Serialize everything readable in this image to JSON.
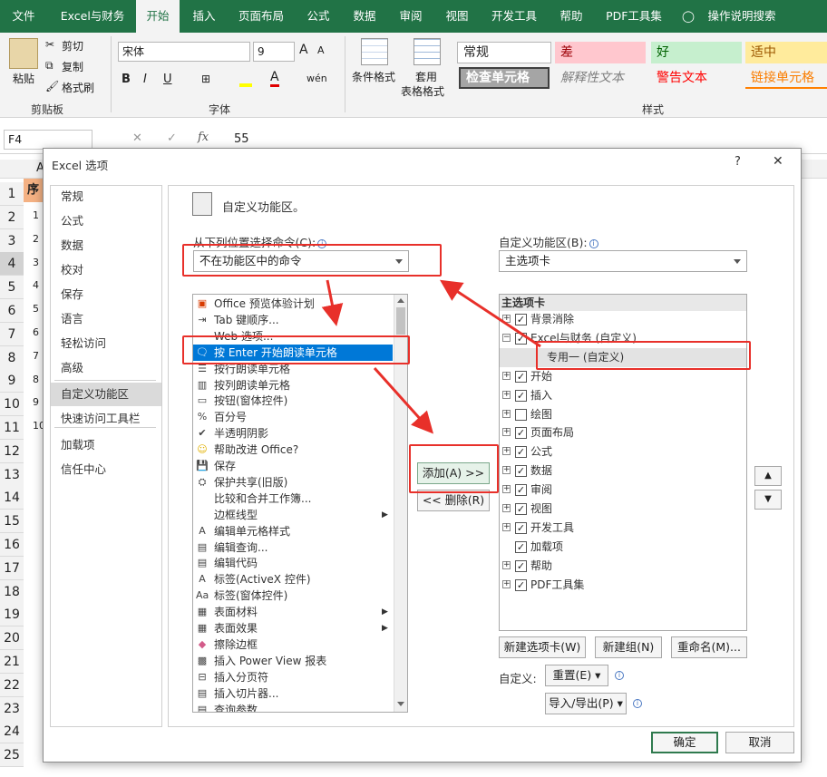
{
  "ribbon_tabs": [
    "文件",
    "Excel与财务",
    "开始",
    "插入",
    "页面布局",
    "公式",
    "数据",
    "审阅",
    "视图",
    "开发工具",
    "帮助",
    "PDF工具集",
    "操作说明搜索"
  ],
  "clipboard": {
    "paste": "粘贴",
    "cut": "剪切",
    "copy": "复制",
    "format_painter": "格式刷",
    "group": "剪贴板"
  },
  "font": {
    "name": "宋体",
    "size": "9",
    "group": "字体",
    "bold": "B",
    "italic": "I",
    "underline": "U"
  },
  "styles": {
    "cond_format": "条件格式",
    "table_format_1": "套用",
    "table_format_2": "表格格式",
    "group": "样式",
    "normal": "常规",
    "bad": "差",
    "good": "好",
    "neutral": "适中",
    "check_cell": "检查单元格",
    "explanatory": "解释性文本",
    "warning": "警告文本",
    "linked_cell": "链接单元格"
  },
  "formula_bar": {
    "cell_ref": "F4",
    "value": "55",
    "fx": "fx"
  },
  "sheet": {
    "col_a": "A",
    "header_cell": "序",
    "rows": [
      "1",
      "2",
      "3",
      "4",
      "5",
      "6",
      "7",
      "8",
      "9",
      "10",
      "11",
      "12",
      "13",
      "14",
      "15",
      "16",
      "17",
      "18",
      "19",
      "20",
      "21",
      "22",
      "23",
      "24",
      "25"
    ],
    "a_values": [
      "1",
      "2",
      "3",
      "4",
      "5",
      "6",
      "7",
      "8",
      "9",
      "10"
    ]
  },
  "dialog": {
    "title": "Excel 选项",
    "help": "?",
    "close": "✕",
    "nav": [
      "常规",
      "公式",
      "数据",
      "校对",
      "保存",
      "语言",
      "轻松访问",
      "高级",
      "自定义功能区",
      "快速访问工具栏",
      "加载项",
      "信任中心"
    ],
    "section_title": "自定义功能区。",
    "left_label": "从下列位置选择命令(C):",
    "left_dropdown": "不在功能区中的命令",
    "right_label": "自定义功能区(B):",
    "right_dropdown": "主选项卡",
    "commands": [
      {
        "icon": "office-icon",
        "text": "Office 预览体验计划"
      },
      {
        "icon": "tab-order-icon",
        "text": "Tab 键顺序..."
      },
      {
        "icon": "web-icon",
        "text": "Web 选项..."
      },
      {
        "icon": "speak-enter-icon",
        "text": "按 Enter 开始朗读单元格"
      },
      {
        "icon": "speak-rows-icon",
        "text": "按行朗读单元格"
      },
      {
        "icon": "speak-cols-icon",
        "text": "按列朗读单元格"
      },
      {
        "icon": "button-form-icon",
        "text": "按钮(窗体控件)"
      },
      {
        "icon": "percent-icon",
        "text": "百分号"
      },
      {
        "icon": "check-icon",
        "text": "半透明阴影"
      },
      {
        "icon": "smiley-icon",
        "text": "帮助改进 Office?"
      },
      {
        "icon": "save-icon",
        "text": "保存"
      },
      {
        "icon": "share-icon",
        "text": "保护共享(旧版)"
      },
      {
        "icon": "blank-icon",
        "text": "比较和合并工作簿..."
      },
      {
        "icon": "blank-icon",
        "text": "边框线型"
      },
      {
        "icon": "cell-style-icon",
        "text": "编辑单元格样式"
      },
      {
        "icon": "query-icon",
        "text": "编辑查询..."
      },
      {
        "icon": "code-icon",
        "text": "编辑代码"
      },
      {
        "icon": "label-icon",
        "text": "标签(ActiveX 控件)"
      },
      {
        "icon": "label-form-icon",
        "text": "标签(窗体控件)"
      },
      {
        "icon": "texture-icon",
        "text": "表面材料"
      },
      {
        "icon": "effect-icon",
        "text": "表面效果"
      },
      {
        "icon": "eraser-icon",
        "text": "擦除边框"
      },
      {
        "icon": "pivot-icon",
        "text": "插入 Power View 报表"
      },
      {
        "icon": "page-break-icon",
        "text": "插入分页符"
      },
      {
        "icon": "slicer-icon",
        "text": "插入切片器..."
      },
      {
        "icon": "param-icon",
        "text": "查询参数"
      }
    ],
    "add_button": "添加(A) >>",
    "remove_button": "<< 删除(R)",
    "tree_header": "主选项卡",
    "tree": [
      {
        "text": "背景消除",
        "checked": true,
        "expand": true,
        "level": 0
      },
      {
        "text": "Excel与财务 (自定义)",
        "checked": true,
        "expand": "minus",
        "level": 0
      },
      {
        "text": "专用一 (自定义)",
        "group": true,
        "level": 1
      },
      {
        "text": "开始",
        "checked": true,
        "expand": true,
        "level": 0
      },
      {
        "text": "插入",
        "checked": true,
        "expand": true,
        "level": 0
      },
      {
        "text": "绘图",
        "checked": false,
        "expand": true,
        "level": 0
      },
      {
        "text": "页面布局",
        "checked": true,
        "expand": true,
        "level": 0
      },
      {
        "text": "公式",
        "checked": true,
        "expand": true,
        "level": 0
      },
      {
        "text": "数据",
        "checked": true,
        "expand": true,
        "level": 0
      },
      {
        "text": "审阅",
        "checked": true,
        "expand": true,
        "level": 0
      },
      {
        "text": "视图",
        "checked": true,
        "expand": true,
        "level": 0
      },
      {
        "text": "开发工具",
        "checked": true,
        "expand": true,
        "level": 0
      },
      {
        "text": "加载项",
        "checked": true,
        "expand": false,
        "level": 0
      },
      {
        "text": "帮助",
        "checked": true,
        "expand": true,
        "level": 0
      },
      {
        "text": "PDF工具集",
        "checked": true,
        "expand": true,
        "level": 0
      }
    ],
    "new_tab": "新建选项卡(W)",
    "new_group": "新建组(N)",
    "rename": "重命名(M)...",
    "customize_label": "自定义:",
    "reset": "重置(E) ▾",
    "import_export": "导入/导出(P) ▾",
    "ok": "确定",
    "cancel": "取消"
  },
  "colors": {
    "ribbon_green": "#217346",
    "selection_blue": "#0078d7",
    "annotation_red": "#e8302a"
  }
}
